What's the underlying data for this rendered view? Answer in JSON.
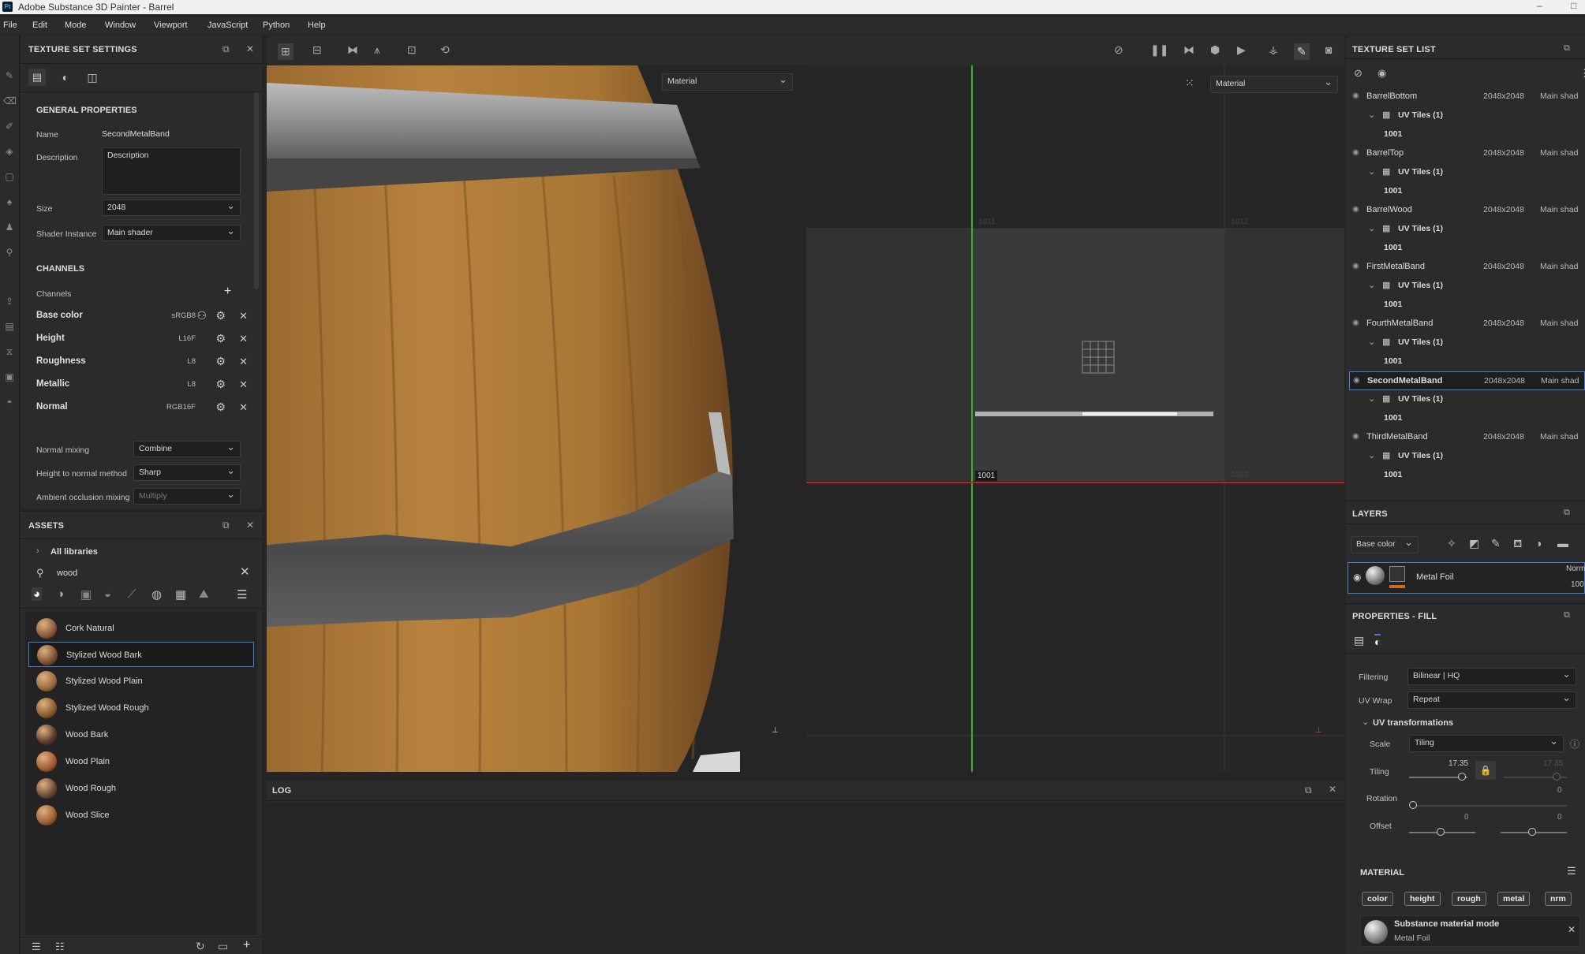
{
  "app": {
    "logo": "Pt",
    "title": "Adobe Substance 3D Painter - Barrel",
    "controls": [
      "–",
      "□"
    ]
  },
  "menu": [
    "File",
    "Edit",
    "Mode",
    "Window",
    "Viewport",
    "JavaScript",
    "Python",
    "Help"
  ],
  "texture_set_settings": {
    "title": "TEXTURE SET SETTINGS",
    "general": "GENERAL PROPERTIES",
    "name_label": "Name",
    "name_value": "SecondMetalBand",
    "description_label": "Description",
    "description_value": "Description",
    "size_label": "Size",
    "size_value": "2048",
    "shader_label": "Shader Instance",
    "shader_value": "Main shader",
    "channels_title": "CHANNELS",
    "channels_label": "Channels",
    "channels": [
      {
        "name": "Base color",
        "format": "sRGB8"
      },
      {
        "name": "Height",
        "format": "L16F"
      },
      {
        "name": "Roughness",
        "format": "L8"
      },
      {
        "name": "Metallic",
        "format": "L8"
      },
      {
        "name": "Normal",
        "format": "RGB16F"
      }
    ],
    "normal_mixing_label": "Normal mixing",
    "normal_mixing_value": "Combine",
    "h2n_label": "Height to normal method",
    "h2n_value": "Sharp",
    "ao_label": "Ambient occlusion mixing",
    "ao_value": "Multiply"
  },
  "assets": {
    "title": "ASSETS",
    "libraries": "All libraries",
    "search": "wood",
    "items": [
      {
        "name": "Cork Natural",
        "color": "#8a5a3a"
      },
      {
        "name": "Stylized Wood Bark",
        "color": "#7a5030"
      },
      {
        "name": "Stylized Wood Plain",
        "color": "#9a6a3a"
      },
      {
        "name": "Stylized Wood Rough",
        "color": "#8a5a30"
      },
      {
        "name": "Wood Bark",
        "color": "#5a3a28"
      },
      {
        "name": "Wood Plain",
        "color": "#a05a30"
      },
      {
        "name": "Wood Rough",
        "color": "#6a4a38"
      },
      {
        "name": "Wood Slice",
        "color": "#9a6030"
      }
    ]
  },
  "viewport": {
    "left_mode": "Material",
    "right_mode": "Material",
    "uv_labels": [
      "1011",
      "1012",
      "1001",
      "1002"
    ]
  },
  "log": {
    "title": "LOG"
  },
  "texture_set_list": {
    "title": "TEXTURE SET LIST",
    "sets": [
      {
        "name": "BarrelBottom",
        "size": "2048x2048",
        "shader": "Main shad",
        "uv": "UV Tiles (1)",
        "tile": "1001"
      },
      {
        "name": "BarrelTop",
        "size": "2048x2048",
        "shader": "Main shad",
        "uv": "UV Tiles (1)",
        "tile": "1001"
      },
      {
        "name": "BarrelWood",
        "size": "2048x2048",
        "shader": "Main shad",
        "uv": "UV Tiles (1)",
        "tile": "1001"
      },
      {
        "name": "FirstMetalBand",
        "size": "2048x2048",
        "shader": "Main shad",
        "uv": "UV Tiles (1)",
        "tile": "1001"
      },
      {
        "name": "FourthMetalBand",
        "size": "2048x2048",
        "shader": "Main shad",
        "uv": "UV Tiles (1)",
        "tile": "1001"
      },
      {
        "name": "SecondMetalBand",
        "size": "2048x2048",
        "shader": "Main shad",
        "uv": "UV Tiles (1)",
        "tile": "1001"
      },
      {
        "name": "ThirdMetalBand",
        "size": "2048x2048",
        "shader": "Main shad",
        "uv": "UV Tiles (1)",
        "tile": "1001"
      }
    ]
  },
  "layers": {
    "title": "LAYERS",
    "channel": "Base color",
    "layer_name": "Metal Foil",
    "blend": "Norm",
    "opacity": "100"
  },
  "properties_fill": {
    "title": "PROPERTIES - FILL",
    "filtering_label": "Filtering",
    "filtering_value": "Bilinear | HQ",
    "uvwrap_label": "UV Wrap",
    "uvwrap_value": "Repeat",
    "uvtrans": "UV transformations",
    "scale_label": "Scale",
    "scale_value": "Tiling",
    "tiling_label": "Tiling",
    "tiling_value": "17.35",
    "tiling_value2": "17.35",
    "rotation_label": "Rotation",
    "rotation_value": "0",
    "offset_label": "Offset",
    "offset_x": "0",
    "offset_y": "0",
    "material_title": "MATERIAL",
    "chips": [
      "color",
      "height",
      "rough",
      "metal",
      "nrm"
    ],
    "mode_title": "Substance material mode",
    "mode_sub": "Metal Foil"
  }
}
